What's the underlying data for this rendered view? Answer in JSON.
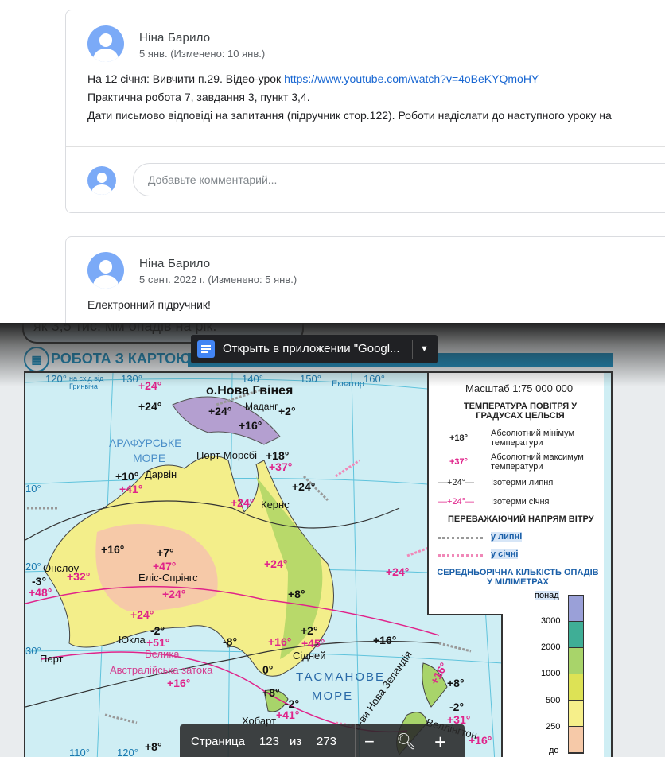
{
  "posts": [
    {
      "author": "Ніна Барило",
      "date": "5 янв. (Изменено: 10 янв.)",
      "lines": [
        "На 12 січня: Вивчити п.29. Відео-урок ",
        "Практична робота 7, завдання 3, пункт 3,4.",
        "Дати письмово відповіді на запитання (підручник стор.122). Роботи надіслати до наступного уроку на"
      ],
      "link": "https://www.youtube.com/watch?v=4oBeKYQmoHY",
      "comment_placeholder": "Добавьте комментарий..."
    },
    {
      "author": "Ніна Барило",
      "date": "5 сент. 2022 г. (Изменено: 5 янв.)",
      "lines": [
        "Електронний підручник!"
      ]
    }
  ],
  "pdf": {
    "note_text": "як 3,5 тис. мм опадів на рік.",
    "section_title": "РОБОТА З КАРТОЮ",
    "open_in_app": "Открыть в приложении \"Googl...",
    "pager": {
      "label": "Страница",
      "page": "123",
      "of": "из",
      "total": "273"
    },
    "map": {
      "labels": [
        "120°",
        "130°",
        "140°",
        "150°",
        "160°",
        "Екватор",
        "на схід від Гринвіча",
        "о.Нова Гвінея",
        "Маданг",
        "+24°",
        "+24°",
        "+24°",
        "+16°",
        "+2°",
        "АРАФУРСЬКЕ",
        "МОРЕ",
        "Порт-Морсбі",
        "+18°",
        "+37°",
        "+10°",
        "Дарвін",
        "+41°",
        "+24°",
        "Кернс",
        "+24°",
        "+16°",
        "Онслоу",
        "+32°",
        "+48°",
        "-3°",
        "+7°",
        "+47°",
        "Еліс-Спрінгс",
        "+24°",
        "+24°",
        "+24°",
        "Юкла",
        "-2°",
        "+51°",
        "Перт",
        "Велика",
        "Австралійська затока",
        "+16°",
        "-8°",
        "+16°",
        "0°",
        "+8°",
        "+2°",
        "+45°",
        "Сідней",
        "+16°",
        "ТАСМАНОВЕ",
        "МОРЕ",
        "+8°",
        "-2°",
        "+41°",
        "Хобарт",
        "о-ви Нова Зеландія",
        "+16°",
        "+8°",
        "-2°",
        "+31°",
        "Веллінгтон",
        "+16°",
        "+8°",
        "110°",
        "120°",
        "10°",
        "20°",
        "30°",
        "+24°"
      ],
      "legend": {
        "scale": "Масштаб 1:75 000 000",
        "temp_title": "ТЕМПЕРАТУРА ПОВІТРЯ У ГРАДУСАХ ЦЕЛЬСІЯ",
        "min_sym": "+18°",
        "min_label": "Абсолютний мінімум температури",
        "max_sym": "+37°",
        "max_label": "Абсолютний максимум температури",
        "jul_sym": "—+24°—",
        "jul_label": "Ізотерми липня",
        "jan_sym": "—+24°—",
        "jan_label": "Ізотерми січня",
        "wind_title": "ПЕРЕВАЖАЮЧИЙ НАПРЯМ ВІТРУ",
        "wind_jul": "у липні",
        "wind_jan": "у січні",
        "precip_title": "СЕРЕДНЬОРІЧНА КІЛЬКІСТЬ ОПАДІВ У МІЛІМЕТРАХ",
        "precip_scale": [
          "понад",
          "3000",
          "2000",
          "1000",
          "500",
          "250",
          "до"
        ],
        "precip_colors": [
          "#9aa0d8",
          "#3fae96",
          "#a8d46a",
          "#dde255",
          "#f6ef8a",
          "#f6c9a8"
        ]
      }
    }
  }
}
